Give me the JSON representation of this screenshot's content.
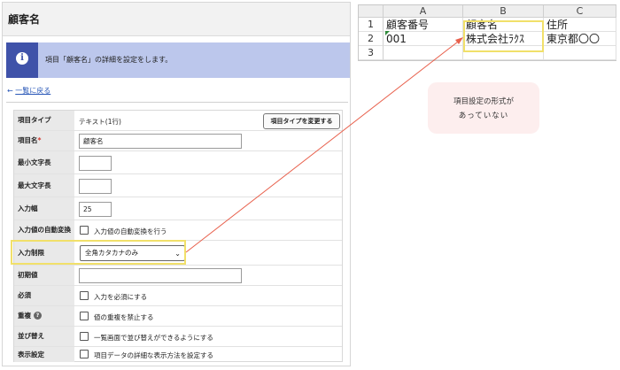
{
  "panel": {
    "title": "顧客名",
    "info_message": "項目「顧客名」の詳細を設定をします。",
    "back_link": "一覧に戻る",
    "back_arrow": "←"
  },
  "form": {
    "rows": {
      "item_type": {
        "label": "項目タイプ",
        "value": "テキスト(1行)",
        "button": "項目タイプを変更する"
      },
      "item_name": {
        "label": "項目名",
        "required_mark": "*",
        "value": "顧客名"
      },
      "min_length": {
        "label": "最小文字長",
        "value": ""
      },
      "max_length": {
        "label": "最大文字長",
        "value": ""
      },
      "input_width": {
        "label": "入力幅",
        "value": "25"
      },
      "auto_convert": {
        "label": "入力値の自動変換",
        "checkbox": "入力値の自動変換を行う"
      },
      "input_restriction": {
        "label": "入力制限",
        "selected": "全角カタカナのみ"
      },
      "initial_value": {
        "label": "初期値",
        "value": ""
      },
      "required": {
        "label": "必須",
        "checkbox": "入力を必須にする"
      },
      "duplicate": {
        "label": "重複",
        "help_icon": "?",
        "checkbox": "値の重複を禁止する"
      },
      "sort": {
        "label": "並び替え",
        "checkbox": "一覧画面で並び替えができるようにする"
      },
      "display": {
        "label": "表示設定",
        "checkbox": "項目データの詳細な表示方法を設定する"
      }
    }
  },
  "sheet": {
    "columns": [
      "A",
      "B",
      "C"
    ],
    "rows": [
      "1",
      "2",
      "3"
    ],
    "cells": [
      [
        "顧客番号",
        "顧客名",
        "住所"
      ],
      [
        "001",
        "株式会社ﾗｸｽ",
        "東京都〇〇"
      ],
      [
        "",
        "",
        ""
      ]
    ]
  },
  "callout": {
    "line1": "項目設定の形式が",
    "line2": "あっていない"
  },
  "colors": {
    "highlight": "#f1e06a",
    "arrow": "#e8604c",
    "info_bg": "#bcc7ec",
    "info_icon": "#3f52a9",
    "callout_bg": "#fdeeee"
  }
}
